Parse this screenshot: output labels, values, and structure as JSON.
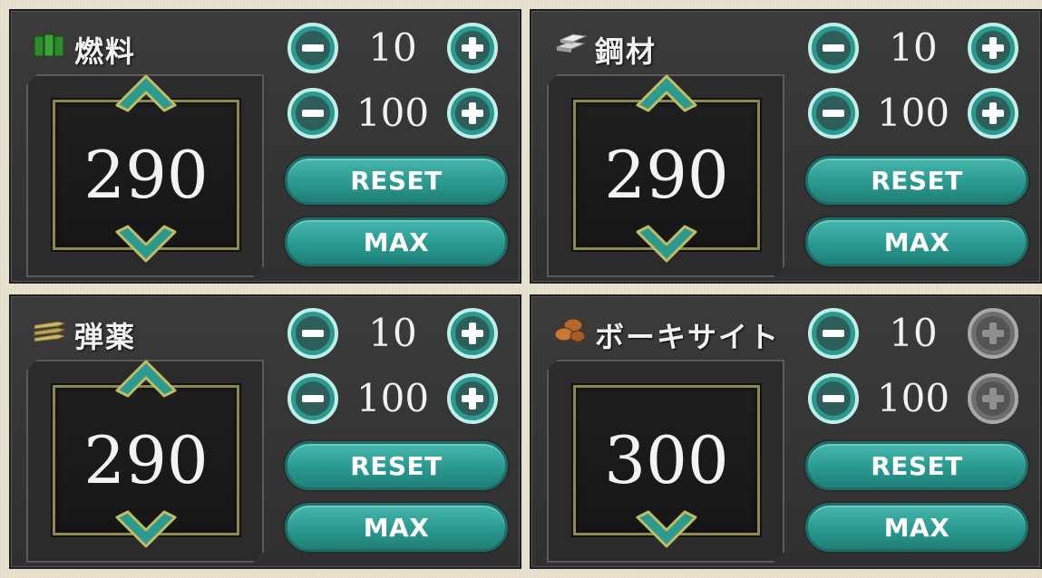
{
  "colors": {
    "accent": "#2a9a91",
    "disabled": "#7a7a7a",
    "gold": "#8d8a49"
  },
  "panels": [
    {
      "name": "燃料",
      "icon": "fuel-icon",
      "value": "290",
      "step_small": "10",
      "step_large": "100",
      "reset_label": "RESET",
      "max_label": "MAX",
      "plus_enabled": true,
      "up_arrow": true
    },
    {
      "name": "鋼材",
      "icon": "steel-icon",
      "value": "290",
      "step_small": "10",
      "step_large": "100",
      "reset_label": "RESET",
      "max_label": "MAX",
      "plus_enabled": true,
      "up_arrow": true
    },
    {
      "name": "弾薬",
      "icon": "ammo-icon",
      "value": "290",
      "step_small": "10",
      "step_large": "100",
      "reset_label": "RESET",
      "max_label": "MAX",
      "plus_enabled": true,
      "up_arrow": true
    },
    {
      "name": "ボーキサイト",
      "icon": "bauxite-icon",
      "value": "300",
      "step_small": "10",
      "step_large": "100",
      "reset_label": "RESET",
      "max_label": "MAX",
      "plus_enabled": false,
      "up_arrow": false
    }
  ]
}
